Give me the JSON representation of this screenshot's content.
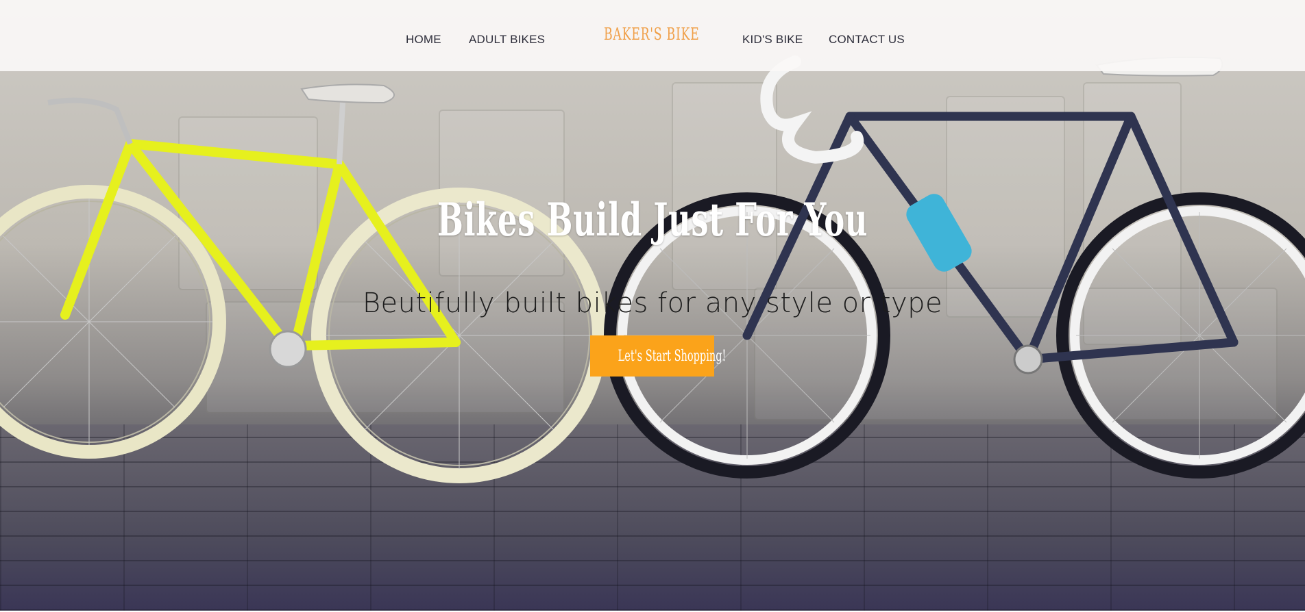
{
  "nav": {
    "home": "HOME",
    "adult_bikes": "ADULT BIKES",
    "brand": "BAKER'S BIKE",
    "kids_bike": "KID'S BIKE",
    "contact_us": "CONTACT US"
  },
  "hero": {
    "title": "Bikes Build Just For You",
    "subtitle": "Beutifully built bikes for any style or type",
    "cta_label": "Let's Start Shopping!",
    "background_image": "two-bicycles-against-wall-photo"
  },
  "colors": {
    "brand": "#f0a04a",
    "cta": "#fba31a",
    "nav_text": "#2d2d3a"
  }
}
